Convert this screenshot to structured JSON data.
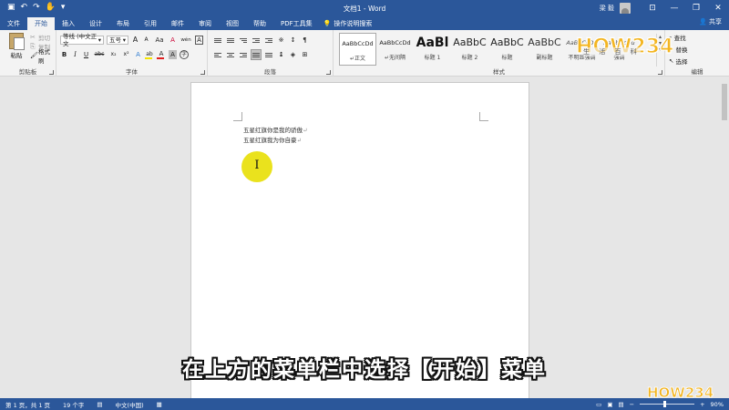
{
  "titlebar": {
    "qat_icons": [
      "save-icon",
      "undo-icon",
      "redo-icon",
      "touch-mode-icon",
      "customize-qat-icon"
    ],
    "doc_title": "文档1 - Word",
    "user_name": "梁 毅",
    "window_buttons": [
      "ribbon-display-icon",
      "minimize-icon",
      "restore-icon",
      "close-icon"
    ]
  },
  "tabs": {
    "items": [
      {
        "label": "文件",
        "state": "file"
      },
      {
        "label": "开始",
        "state": "active"
      },
      {
        "label": "插入",
        "state": ""
      },
      {
        "label": "设计",
        "state": ""
      },
      {
        "label": "布局",
        "state": ""
      },
      {
        "label": "引用",
        "state": ""
      },
      {
        "label": "邮件",
        "state": ""
      },
      {
        "label": "审阅",
        "state": ""
      },
      {
        "label": "视图",
        "state": ""
      },
      {
        "label": "帮助",
        "state": ""
      },
      {
        "label": "PDF工具集",
        "state": ""
      }
    ],
    "tell_me": "操作说明搜索",
    "share": "共享"
  },
  "clipboard": {
    "paste": "粘贴",
    "cut": "剪切",
    "copy": "复制",
    "format_painter": "格式刷",
    "group_label": "剪贴板"
  },
  "font": {
    "font_name": "等线 (中文正文",
    "font_size": "五号",
    "grow": "A",
    "shrink": "A",
    "case": "Aa",
    "clear": "A",
    "wen": "wén",
    "char_border": "A",
    "bold": "B",
    "italic": "I",
    "underline": "U",
    "strike": "abc",
    "sub": "x₂",
    "sup": "x²",
    "effects": "A",
    "highlight": "ab",
    "font_color": "A",
    "shading": "A",
    "enclose": "字",
    "group_label": "字体",
    "highlight_color": "#f5e400",
    "font_color_value": "#e02020"
  },
  "paragraph": {
    "group_label": "段落"
  },
  "styles": {
    "items": [
      {
        "sample": "AaBbCcDd",
        "name": "↵正文",
        "size": "6.5px",
        "bold": false,
        "italic": false,
        "color": "#222",
        "selected": true
      },
      {
        "sample": "AaBbCcDd",
        "name": "↵无间隔",
        "size": "6.5px",
        "bold": false,
        "italic": false,
        "color": "#222",
        "selected": false
      },
      {
        "sample": "AaBl",
        "name": "标题 1",
        "size": "14px",
        "bold": true,
        "italic": false,
        "color": "#111",
        "selected": false
      },
      {
        "sample": "AaBbC",
        "name": "标题 2",
        "size": "11px",
        "bold": false,
        "italic": false,
        "color": "#222",
        "selected": false
      },
      {
        "sample": "AaBbC",
        "name": "标题",
        "size": "11px",
        "bold": false,
        "italic": false,
        "color": "#222",
        "selected": false
      },
      {
        "sample": "AaBbC",
        "name": "副标题",
        "size": "11px",
        "bold": false,
        "italic": false,
        "color": "#333",
        "selected": false
      },
      {
        "sample": "AaBbCcDd",
        "name": "不明显强调",
        "size": "6.5px",
        "bold": false,
        "italic": true,
        "color": "#555",
        "selected": false
      },
      {
        "sample": "AaBbCcDd",
        "name": "强调",
        "size": "6.5px",
        "bold": false,
        "italic": true,
        "color": "#555",
        "selected": false
      }
    ],
    "group_label": "样式"
  },
  "editing": {
    "find": "查找",
    "replace": "替换",
    "select": "选择",
    "group_label": "编辑"
  },
  "watermark": {
    "top_text": "生 活 百 科",
    "logo_text": "HOW234"
  },
  "document": {
    "lines": [
      "五星红旗你是我的骄傲",
      "五星红旗我为你自豪"
    ],
    "paragraph_mark": "↵",
    "ibeam": "I"
  },
  "subtitle": "在上方的菜单栏中选择【开始】菜单",
  "status": {
    "page": "第 1 页，共 1 页",
    "words": "19 个字",
    "lang": "中文(中国)",
    "zoom": "90%",
    "zoom_fraction": 0.45
  }
}
